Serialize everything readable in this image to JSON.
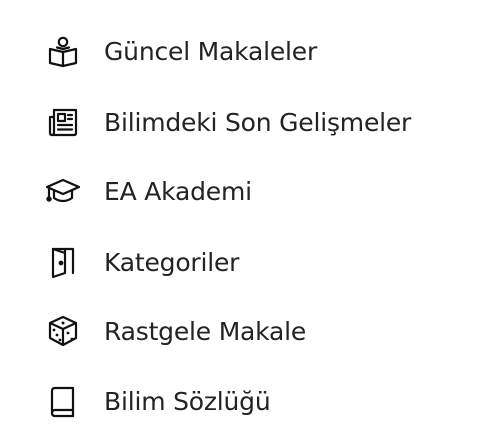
{
  "menu": {
    "items": [
      {
        "label": "Güncel Makaleler",
        "icon": "open-book-person-icon"
      },
      {
        "label": "Bilimdeki Son Gelişmeler",
        "icon": "newspaper-icon"
      },
      {
        "label": "EA Akademi",
        "icon": "graduation-cap-icon"
      },
      {
        "label": "Kategoriler",
        "icon": "door-icon"
      },
      {
        "label": "Rastgele Makale",
        "icon": "dice-icon"
      },
      {
        "label": "Bilim Sözlüğü",
        "icon": "book-icon"
      }
    ]
  },
  "colors": {
    "text": "#232323",
    "icon": "#111111",
    "background": "#ffffff"
  }
}
